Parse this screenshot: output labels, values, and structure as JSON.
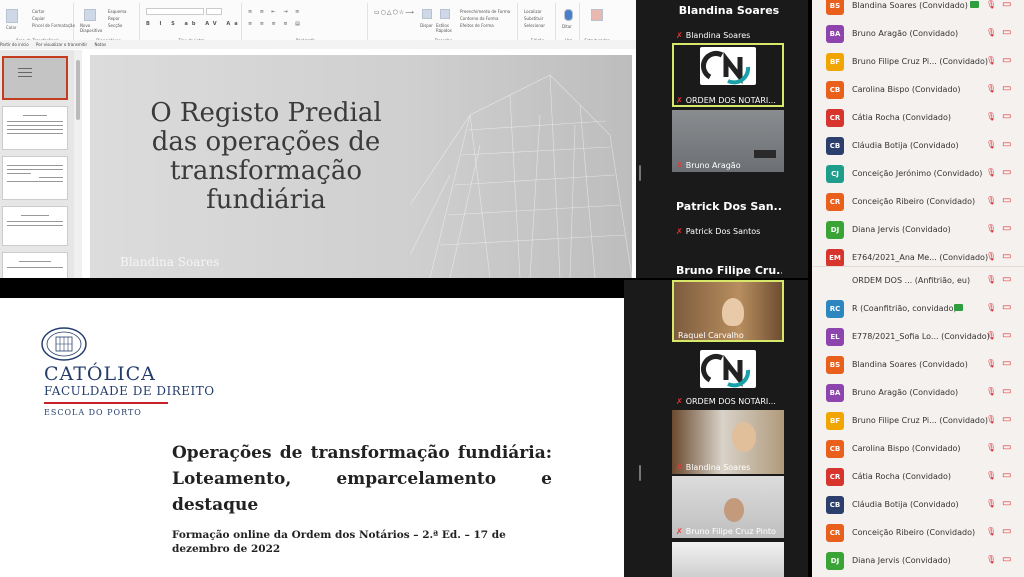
{
  "ppt": {
    "ribbon_groups": [
      "Área de Transferência",
      "Diapositivos",
      "Tipo de Letra",
      "Parágrafo",
      "Desenho",
      "Edição",
      "Voz",
      "Estruturador"
    ],
    "clipboard": {
      "paste": "Colar",
      "cut": "Cortar",
      "copy": "Copiar",
      "painter": "Pincel de Formatação"
    },
    "slides": {
      "new": "Novo Diapositivo",
      "layout": "Esquema",
      "reset": "Repor",
      "section": "Secção"
    },
    "draw": {
      "arrange": "Dispor",
      "styles": "Estilos Rápidos",
      "fill": "Preenchimento de Forma",
      "outline": "Contorno da Forma",
      "effects": "Efeitos de Forma"
    },
    "edit": {
      "find": "Localizar",
      "replace": "Substituir",
      "select": "Selecionar"
    },
    "voice": "Ditar",
    "designer": "Estruturador",
    "bar": [
      "Partir do início",
      "Por visualizar o transmitir",
      "Notas"
    ],
    "slide": {
      "title": "O Registo Predial das operações de transformação fundiária",
      "author": "Blandina Soares"
    }
  },
  "slide2": {
    "university": "CATÓLICA",
    "faculty": "FACULDADE DE DIREITO",
    "school": "ESCOLA DO PORTO",
    "title": "Operações de transformação fundiária: Loteamento, emparcelamento e destaque",
    "subtitle": "Formação online da Ordem dos Notários – 2.ª Ed. – 17 de dezembro de 2022"
  },
  "video_top": {
    "speaker_big": "Blandina Soares",
    "tiles": [
      {
        "name": "Blandina Soares"
      },
      {
        "name": "ORDEM DOS NOTÁRI..."
      },
      {
        "name": "Bruno Aragão"
      },
      {
        "name": "Patrick Dos Santos",
        "big": "Patrick Dos San..."
      },
      {
        "big": "Bruno Filipe Cru..."
      }
    ]
  },
  "video_bottom": {
    "tiles": [
      {
        "name": "Raquel Carvalho"
      },
      {
        "name": "ORDEM DOS NOTÁRI..."
      },
      {
        "name": "Blandina Soares"
      },
      {
        "name": "Bruno Filipe Cruz Pinto"
      }
    ]
  },
  "participants_top": [
    {
      "initials": "BS",
      "name": "Blandina Soares (Convidado)",
      "color": "#e8601c"
    },
    {
      "initials": "BA",
      "name": "Bruno Aragão (Convidado)",
      "color": "#8e44ad"
    },
    {
      "initials": "BF",
      "name": "Bruno Filipe Cruz Pi...  (Convidado)",
      "color": "#f0a500"
    },
    {
      "initials": "CB",
      "name": "Carolina Bispo (Convidado)",
      "color": "#e8601c"
    },
    {
      "initials": "CR",
      "name": "Cátia Rocha (Convidado)",
      "color": "#d6342c"
    },
    {
      "initials": "CB",
      "name": "Cláudia Botija (Convidado)",
      "color": "#2c3e6b"
    },
    {
      "initials": "CJ",
      "name": "Conceição Jerónimo (Convidado)",
      "color": "#1e9e8a"
    },
    {
      "initials": "CR",
      "name": "Conceição Ribeiro (Convidado)",
      "color": "#e8601c"
    },
    {
      "initials": "DJ",
      "name": "Diana Jervis (Convidado)",
      "color": "#3aa335"
    },
    {
      "initials": "EM",
      "name": "E764/2021_Ana Me...  (Convidado)",
      "color": "#d6342c"
    }
  ],
  "participants_bottom": [
    {
      "initials": "",
      "name": "ORDEM DOS ...  (Anfitrião, eu)",
      "color": "#888888"
    },
    {
      "initials": "RC",
      "name": "R (Coanfitrião, convidado)",
      "color": "#2e86c1"
    },
    {
      "initials": "EL",
      "name": "E778/2021_Sofia Lo...  (Convidado)",
      "color": "#8e44ad"
    },
    {
      "initials": "BS",
      "name": "Blandina Soares (Convidado)",
      "color": "#e8601c"
    },
    {
      "initials": "BA",
      "name": "Bruno Aragão (Convidado)",
      "color": "#8e44ad"
    },
    {
      "initials": "BF",
      "name": "Bruno Filipe Cruz Pi...  (Convidado)",
      "color": "#f0a500"
    },
    {
      "initials": "CB",
      "name": "Carolina Bispo (Convidado)",
      "color": "#e8601c"
    },
    {
      "initials": "CR",
      "name": "Cátia Rocha (Convidado)",
      "color": "#d6342c"
    },
    {
      "initials": "CB",
      "name": "Cláudia Botija (Convidado)",
      "color": "#2c3e6b"
    },
    {
      "initials": "CR",
      "name": "Conceição Ribeiro (Convidado)",
      "color": "#e8601c"
    },
    {
      "initials": "DJ",
      "name": "Diana Jervis (Convidado)",
      "color": "#3aa335"
    }
  ]
}
